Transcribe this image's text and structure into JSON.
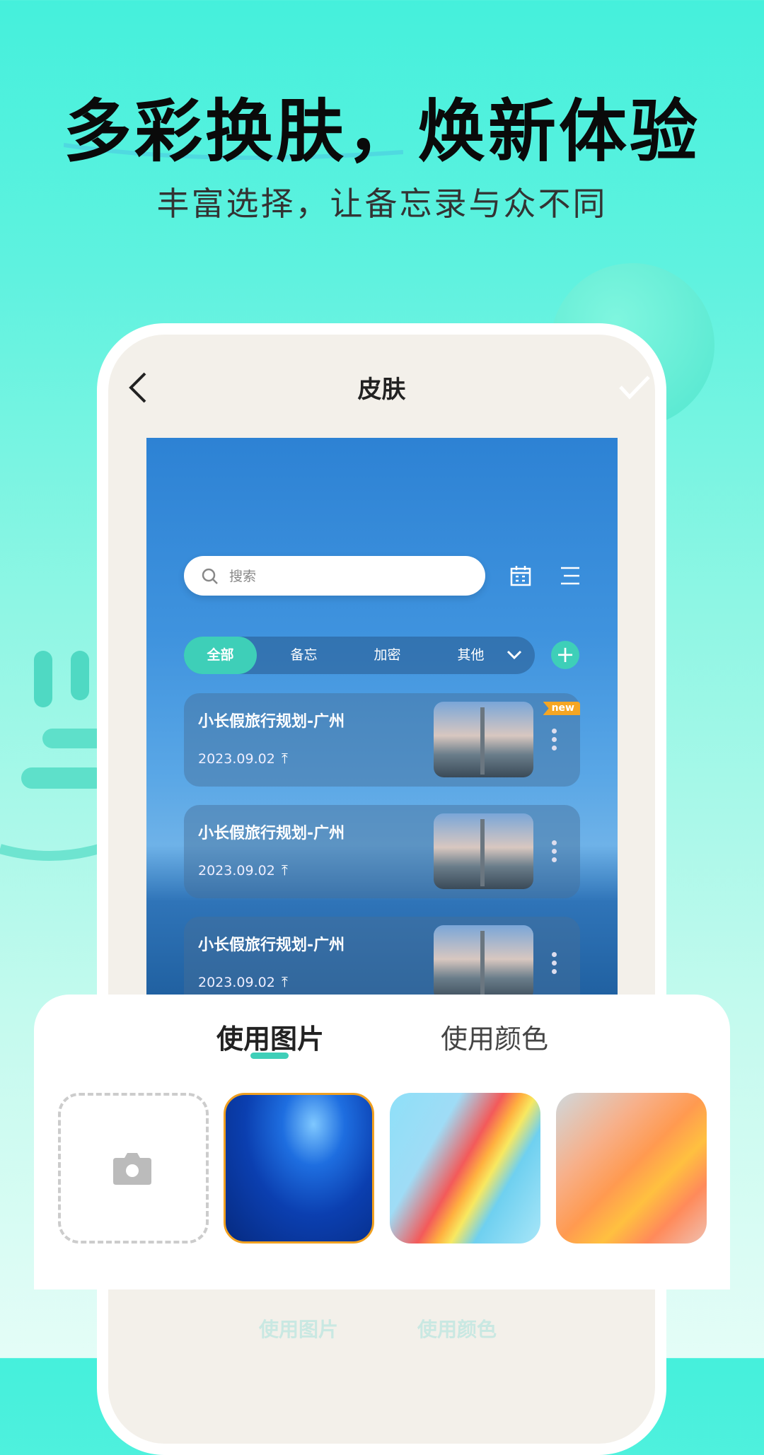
{
  "promo": {
    "headline": "多彩换肤，焕新体验",
    "subtitle": "丰富选择，让备忘录与众不同"
  },
  "header": {
    "title": "皮肤",
    "back_icon": "chevron-left-icon",
    "confirm_icon": "check-icon"
  },
  "preview": {
    "search_placeholder": "搜索",
    "tabs": [
      {
        "label": "全部",
        "active": true
      },
      {
        "label": "备忘"
      },
      {
        "label": "加密"
      },
      {
        "label": "其他"
      }
    ],
    "cards": [
      {
        "title": "小长假旅行规划-广州",
        "date": "2023.09.02",
        "pin": "⤒",
        "badge": "new"
      },
      {
        "title": "小长假旅行规划-广州",
        "date": "2023.09.02",
        "pin": "⤒"
      },
      {
        "title": "小长假旅行规划-广州",
        "date": "2023.09.02",
        "pin": "⤒"
      }
    ]
  },
  "sheet": {
    "tabs": [
      {
        "label": "使用图片",
        "active": true
      },
      {
        "label": "使用颜色"
      }
    ],
    "selected_index": 1
  },
  "faded_tabs": [
    "使用图片",
    "使用颜色"
  ],
  "colors": {
    "accent": "#3ecfb8",
    "badge": "#f5a623",
    "selected_border": "#f0a020"
  }
}
